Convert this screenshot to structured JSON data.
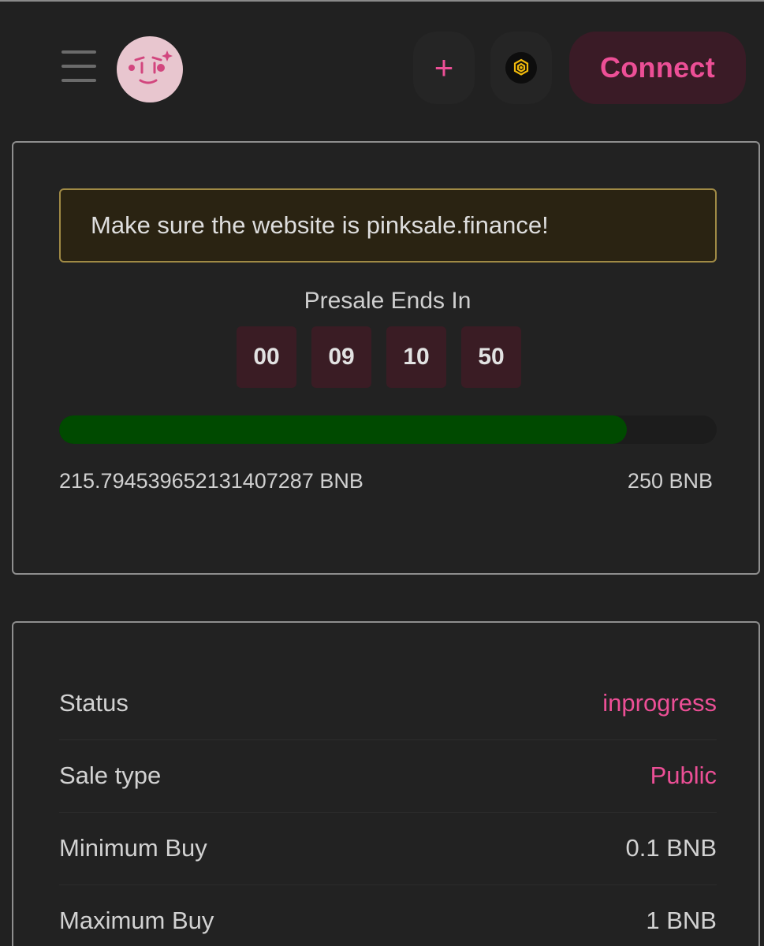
{
  "header": {
    "connect_label": "Connect",
    "plus_icon": "+",
    "icons": [
      "menu-icon",
      "pinksale-logo",
      "plus-icon",
      "bnb-chain-icon"
    ]
  },
  "presale": {
    "warning": "Make sure the website is pinksale.finance!",
    "title": "Presale Ends In",
    "countdown": [
      "00",
      "09",
      "10",
      "50"
    ],
    "raised": "215.794539652131407287 BNB",
    "cap": "250 BNB",
    "progress_percent": 86.3
  },
  "info": {
    "rows": [
      {
        "label": "Status",
        "value": "inprogress"
      },
      {
        "label": "Sale type",
        "value": "Public"
      },
      {
        "label": "Minimum Buy",
        "value": "0.1 BNB"
      },
      {
        "label": "Maximum Buy",
        "value": "1 BNB"
      }
    ]
  },
  "colors": {
    "accent": "#ec4f96",
    "progress": "#004a00",
    "background": "#212121"
  }
}
